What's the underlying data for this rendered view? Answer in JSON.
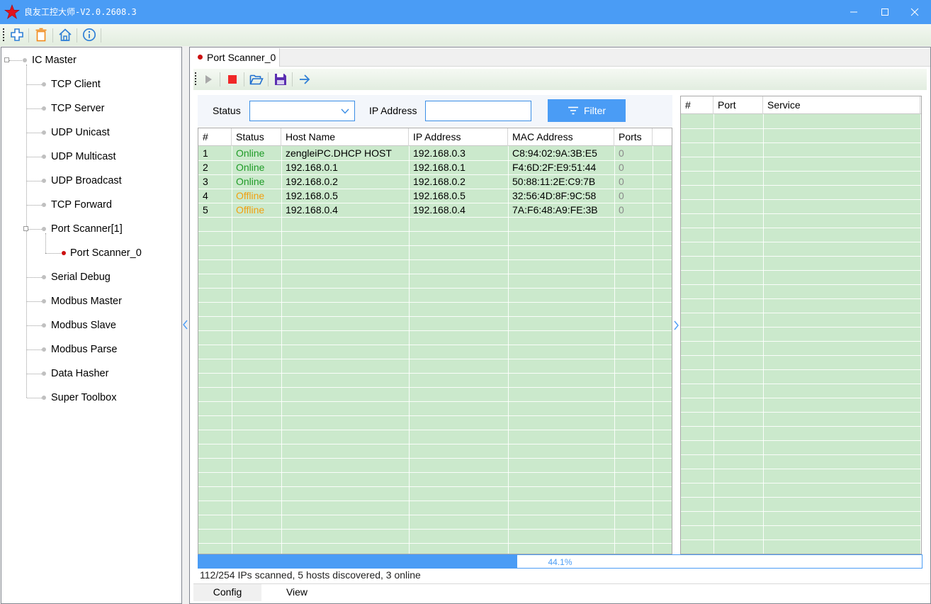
{
  "app": {
    "title": "良友工控大师-V2.0.2608.3"
  },
  "toolbar": {
    "icons": [
      "add-icon",
      "delete-icon",
      "home-icon",
      "info-icon"
    ]
  },
  "tree": {
    "root": "IC Master",
    "items": [
      {
        "label": "TCP Client"
      },
      {
        "label": "TCP Server"
      },
      {
        "label": "UDP Unicast"
      },
      {
        "label": "UDP Multicast"
      },
      {
        "label": "UDP Broadcast"
      },
      {
        "label": "TCP Forward"
      },
      {
        "label": "Port Scanner[1]"
      },
      {
        "label": "Port Scanner_0"
      },
      {
        "label": "Serial Debug"
      },
      {
        "label": "Modbus Master"
      },
      {
        "label": "Modbus Slave"
      },
      {
        "label": "Modbus Parse"
      },
      {
        "label": "Data Hasher"
      },
      {
        "label": "Super Toolbox"
      }
    ]
  },
  "doc_tab": {
    "label": "Port Scanner_0"
  },
  "filter": {
    "status_label": "Status",
    "status_value": "",
    "ip_label": "IP Address",
    "ip_value": "",
    "filter_button": "Filter"
  },
  "hosts": {
    "columns": [
      "#",
      "Status",
      "Host Name",
      "IP Address",
      "MAC Address",
      "Ports"
    ],
    "rows": [
      {
        "num": "1",
        "status": "Online",
        "host": "zengleiPC.DHCP HOST",
        "ip": "192.168.0.3",
        "mac": "C8:94:02:9A:3B:E5",
        "ports": "0"
      },
      {
        "num": "2",
        "status": "Online",
        "host": "192.168.0.1",
        "ip": "192.168.0.1",
        "mac": "F4:6D:2F:E9:51:44",
        "ports": "0"
      },
      {
        "num": "3",
        "status": "Online",
        "host": "192.168.0.2",
        "ip": "192.168.0.2",
        "mac": "50:88:11:2E:C9:7B",
        "ports": "0"
      },
      {
        "num": "4",
        "status": "Offline",
        "host": "192.168.0.5",
        "ip": "192.168.0.5",
        "mac": "32:56:4D:8F:9C:58",
        "ports": "0"
      },
      {
        "num": "5",
        "status": "Offline",
        "host": "192.168.0.4",
        "ip": "192.168.0.4",
        "mac": "7A:F6:48:A9:FE:3B",
        "ports": "0"
      }
    ]
  },
  "ports": {
    "columns": [
      "#",
      "Port",
      "Service"
    ],
    "rows": []
  },
  "progress": {
    "percent": 44.1,
    "label": "44.1%"
  },
  "status_text": "112/254 IPs scanned, 5 hosts discovered, 3 online",
  "bottom_tabs": [
    {
      "label": "Config"
    },
    {
      "label": "View"
    }
  ],
  "colors": {
    "accent": "#4a9cf5",
    "grid_bg": "#cbe9cc",
    "online": "#1f9b27",
    "offline": "#f0a010"
  }
}
